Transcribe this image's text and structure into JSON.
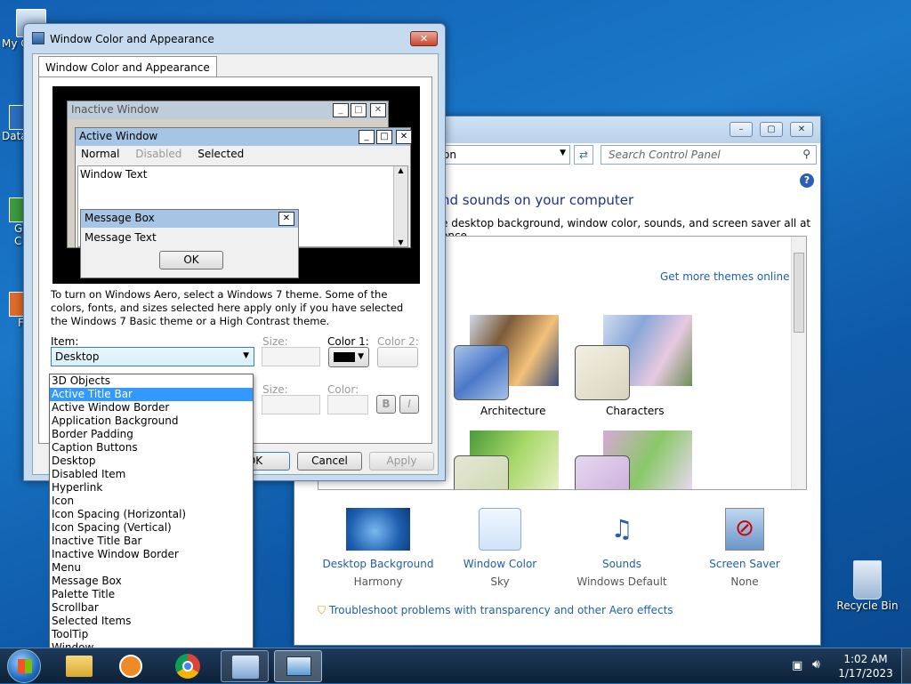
{
  "desktop": {
    "icons": [
      {
        "label": "My C",
        "icon": "computer-icon"
      },
      {
        "label": "Data",
        "icon": "shortcut-icon"
      },
      {
        "label": "G C",
        "icon": "shortcut-icon"
      },
      {
        "label": "F",
        "icon": "shortcut-icon"
      },
      {
        "label": "Recycle Bin",
        "icon": "recycle-bin-icon"
      }
    ]
  },
  "control_panel": {
    "address_text": "on",
    "search_placeholder": "Search Control Panel",
    "heading": "nd sounds on your computer",
    "subheading": "e desktop background, window color, sounds, and screen saver all at once.",
    "get_more_themes": "Get more themes online",
    "themes": [
      {
        "label": "Architecture"
      },
      {
        "label": "Characters"
      }
    ],
    "bottom_items": [
      {
        "title": "Desktop Background",
        "sub": "Harmony"
      },
      {
        "title": "Window Color",
        "sub": "Sky"
      },
      {
        "title": "Sounds",
        "sub": "Windows Default"
      },
      {
        "title": "Screen Saver",
        "sub": "None"
      }
    ],
    "troubleshoot": "Troubleshoot problems with transparency and other Aero effects"
  },
  "dialog": {
    "title": "Window Color and Appearance",
    "tab_label": "Window Color and Appearance",
    "preview": {
      "inactive_title": "Inactive Window",
      "active_title": "Active Window",
      "menu_normal": "Normal",
      "menu_disabled": "Disabled",
      "menu_selected": "Selected",
      "window_text": "Window Text",
      "msgbox_title": "Message Box",
      "msgbox_text": "Message Text",
      "ok": "OK"
    },
    "description": "To turn on Windows Aero, select a Windows 7 theme.  Some of the colors, fonts, and sizes selected here apply only if you have selected the Windows 7 Basic theme or a High Contrast theme.",
    "item_label": "Item:",
    "size_label": "Size:",
    "color1_label": "Color 1:",
    "color2_label": "Color 2:",
    "font_size_label": "Size:",
    "font_color_label": "Color:",
    "bold": "B",
    "italic": "I",
    "selected_item": "Desktop",
    "ok_button": "OK",
    "cancel_button": "Cancel",
    "apply_button": "Apply",
    "dropdown_items": [
      "3D Objects",
      "Active Title Bar",
      "Active Window Border",
      "Application Background",
      "Border Padding",
      "Caption Buttons",
      "Desktop",
      "Disabled Item",
      "Hyperlink",
      "Icon",
      "Icon Spacing (Horizontal)",
      "Icon Spacing (Vertical)",
      "Inactive Title Bar",
      "Inactive Window Border",
      "Menu",
      "Message Box",
      "Palette Title",
      "Scrollbar",
      "Selected Items",
      "ToolTip",
      "Window"
    ],
    "highlighted_item": "Active Title Bar"
  },
  "taskbar": {
    "time": "1:02 AM",
    "date": "1/17/2023"
  }
}
